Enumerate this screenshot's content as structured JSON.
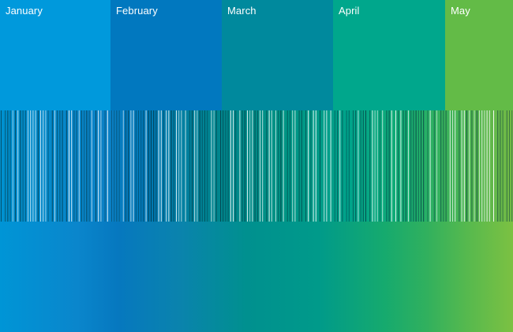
{
  "months": [
    {
      "label": "January",
      "color": "#0099dc"
    },
    {
      "label": "February",
      "color": "#0178bf"
    },
    {
      "label": "March",
      "color": "#00899d"
    },
    {
      "label": "April",
      "color": "#00a78c"
    },
    {
      "label": "May",
      "color": "#63bb47"
    }
  ],
  "colors": {
    "stripe_dark": "#04343f",
    "stripe_light": "#ffffff"
  }
}
